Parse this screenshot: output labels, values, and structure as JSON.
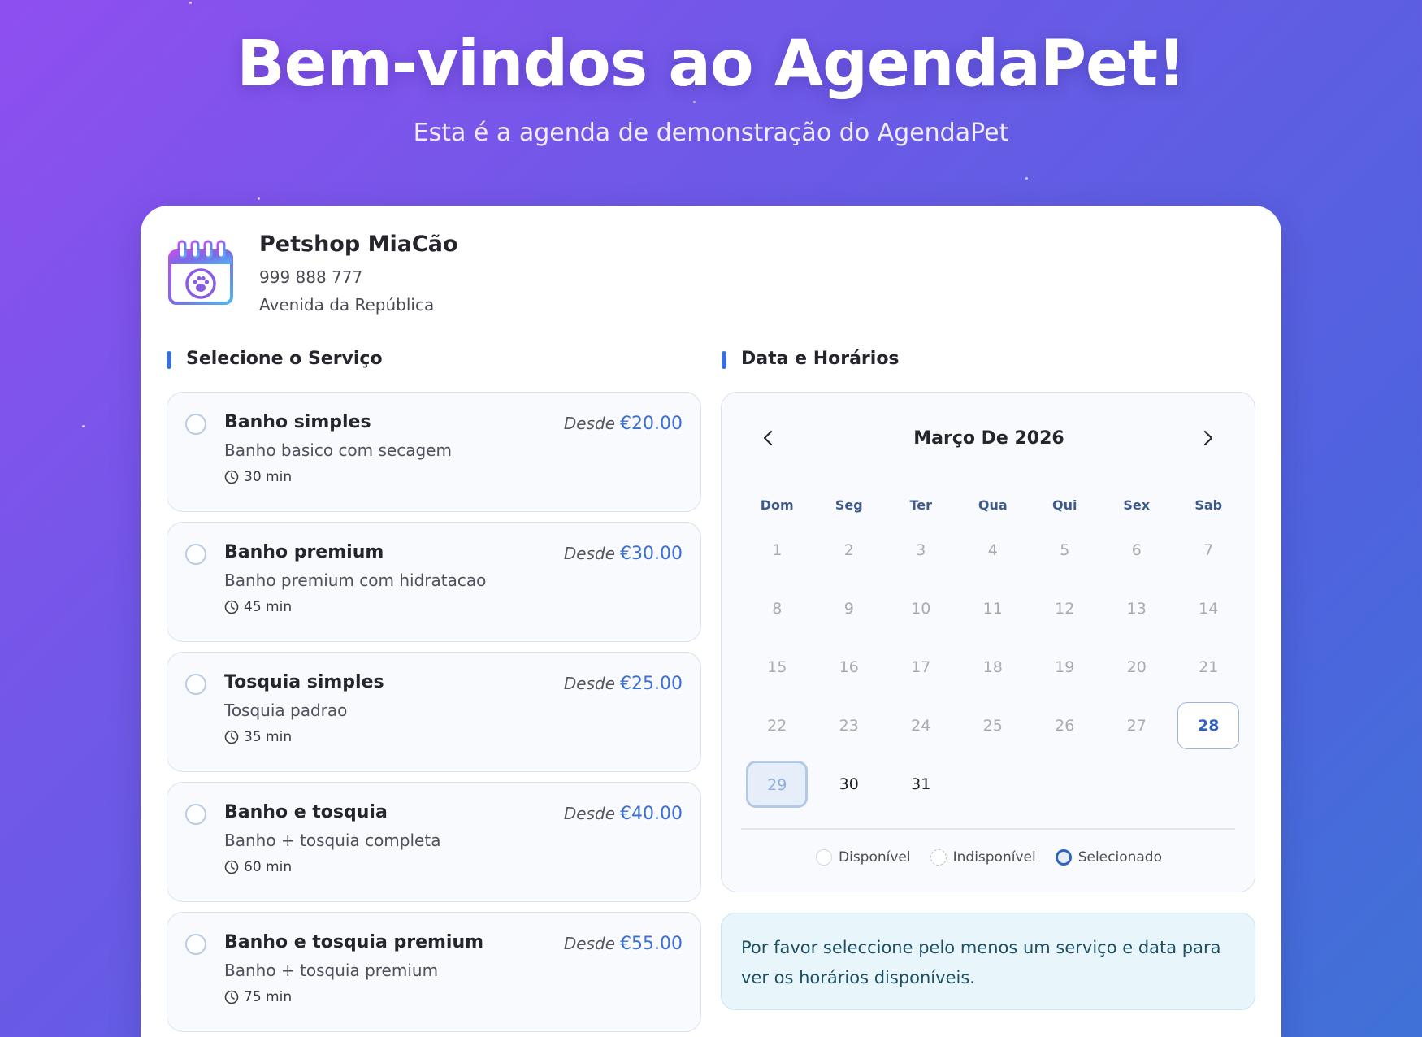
{
  "hero": {
    "title": "Bem-vindos ao AgendaPet!",
    "subtitle": "Esta é a agenda de demonstração do AgendaPet"
  },
  "shop": {
    "name": "Petshop MiaCão",
    "phone": "999 888 777",
    "address": "Avenida da República",
    "logo_icon": "calendar-paw-icon"
  },
  "services_section": {
    "title": "Selecione o Serviço",
    "price_prefix": "Desde",
    "items": [
      {
        "name": "Banho simples",
        "description": "Banho basico com secagem",
        "duration": "30 min",
        "price": "€20.00"
      },
      {
        "name": "Banho premium",
        "description": "Banho premium com hidratacao",
        "duration": "45 min",
        "price": "€30.00"
      },
      {
        "name": "Tosquia simples",
        "description": "Tosquia padrao",
        "duration": "35 min",
        "price": "€25.00"
      },
      {
        "name": "Banho e tosquia",
        "description": "Banho + tosquia completa",
        "duration": "60 min",
        "price": "€40.00"
      },
      {
        "name": "Banho e tosquia premium",
        "description": "Banho + tosquia premium",
        "duration": "75 min",
        "price": "€55.00"
      }
    ]
  },
  "calendar_section": {
    "title": "Data e Horários",
    "month_label": "Março De 2026",
    "weekdays": [
      "Dom",
      "Seg",
      "Ter",
      "Qua",
      "Qui",
      "Sex",
      "Sab"
    ],
    "weeks": [
      [
        "1",
        "2",
        "3",
        "4",
        "5",
        "6",
        "7"
      ],
      [
        "8",
        "9",
        "10",
        "11",
        "12",
        "13",
        "14"
      ],
      [
        "15",
        "16",
        "17",
        "18",
        "19",
        "20",
        "21"
      ],
      [
        "22",
        "23",
        "24",
        "25",
        "26",
        "27",
        "28"
      ],
      [
        "29",
        "30",
        "31",
        "",
        "",
        "",
        ""
      ]
    ],
    "today": "28",
    "selected": "29",
    "available": [
      "30",
      "31"
    ],
    "legend": {
      "available": "Disponível",
      "unavailable": "Indisponível",
      "selected": "Selecionado"
    }
  },
  "notice": {
    "text": "Por favor seleccione pelo menos um serviço e data para ver os horários disponíveis."
  },
  "colors": {
    "accent": "#3b6fd4",
    "gradient_start": "#8f4ff0",
    "gradient_end": "#3f72d6"
  }
}
